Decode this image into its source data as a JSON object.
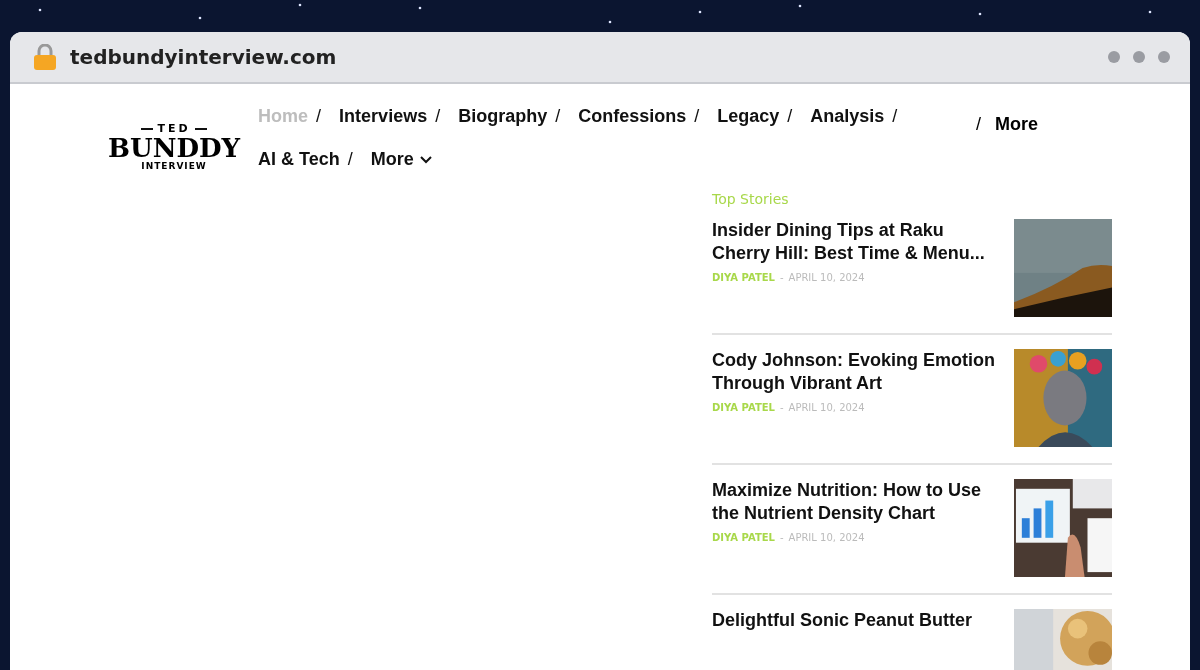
{
  "browser": {
    "url": "tedbundyinterview.com"
  },
  "logo": {
    "top": "TED",
    "main": "BUNDDY",
    "sub": "INTERVIEW"
  },
  "nav": [
    {
      "label": "Home",
      "selected": true,
      "separator": "/",
      "dropdown": false
    },
    {
      "label": "Interviews",
      "selected": false,
      "separator": "/",
      "dropdown": false
    },
    {
      "label": "Biography",
      "selected": false,
      "separator": "/",
      "dropdown": false
    },
    {
      "label": "Confessions",
      "selected": false,
      "separator": "/",
      "dropdown": false
    },
    {
      "label": "Legacy",
      "selected": false,
      "separator": "/",
      "dropdown": false
    },
    {
      "label": "Analysis",
      "selected": false,
      "separator": "/",
      "dropdown": false
    },
    {
      "label": "AI & Tech",
      "selected": false,
      "separator": "/",
      "dropdown": false
    },
    {
      "label": "More",
      "selected": false,
      "dropdown": true
    }
  ],
  "nav_right": {
    "separator": "/",
    "label": "More"
  },
  "top_stories": {
    "heading": "Top Stories",
    "items": [
      {
        "title": "Insider Dining Tips at Raku Cherry Hill: Best Time & Menu...",
        "author": "DIYA PATEL",
        "separator": "-",
        "date": "APRIL 10, 2024",
        "kind": "picture"
      },
      {
        "title": "Cody Johnson: Evoking Emotion Through Vibrant Art",
        "author": "DIYA PATEL",
        "separator": "-",
        "date": "APRIL 10, 2024",
        "kind": "picture"
      },
      {
        "title": "Maximize Nutrition: How to Use the Nutrient Density Chart",
        "author": "DIYA PATEL",
        "separator": "-",
        "date": "APRIL 10, 2024",
        "kind": "picture"
      },
      {
        "title": "Delightful Sonic Peanut Butter",
        "kind": "picture"
      }
    ]
  }
}
